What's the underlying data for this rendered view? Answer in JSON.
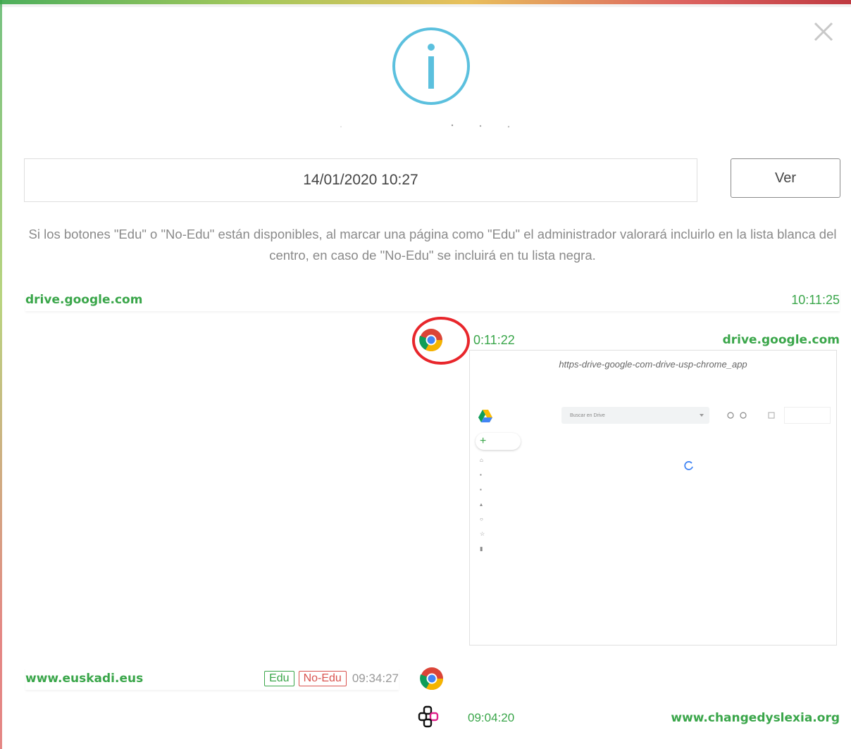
{
  "dialog": {
    "close_icon": "close-icon",
    "header_icon": "info-icon",
    "date_value": "14/01/2020 10:27",
    "view_button": "Ver",
    "info_text": "Si los botones \"Edu\" o \"No-Edu\" están disponibles, al marcar una página como \"Edu\" el administrador valorará incluirlo en la lista blanca del centro, en caso de \"No-Edu\" se incluirá en tu lista negra."
  },
  "entries": [
    {
      "site": "drive.google.com",
      "time": "10:11:25"
    },
    {
      "site": "drive.google.com",
      "time": "0:11:22",
      "browser_icon": "chrome-icon",
      "screenshot": {
        "title": "https-drive-google-com-drive-usp-chrome_app",
        "search_placeholder": "Buscar en Drive"
      }
    },
    {
      "site": "www.euskadi.eus",
      "time": "09:34:27",
      "edu_label": "Edu",
      "noedu_label": "No-Edu",
      "browser_icon": "chrome-icon"
    },
    {
      "site": "www.changedyslexia.org",
      "time": "09:04:20",
      "browser_icon": "app-icon"
    }
  ],
  "colors": {
    "accent_green": "#3aa64a",
    "info_blue": "#5bc0de",
    "highlight_red": "#e8262b",
    "noedu_red": "#d9534f"
  }
}
